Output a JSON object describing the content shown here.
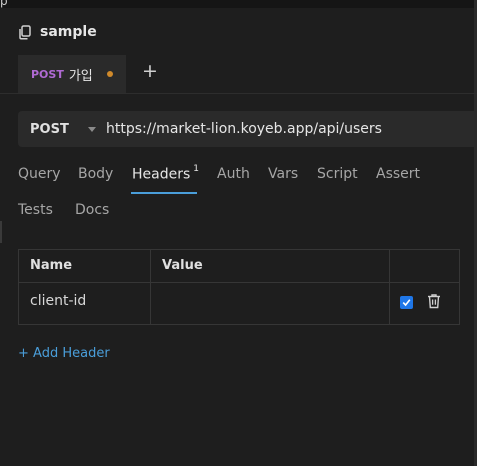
{
  "window": {
    "corner_glyph": "p"
  },
  "collection": {
    "icon": "copy-icon",
    "title": "sample"
  },
  "tabs": [
    {
      "method": "POST",
      "name": "가입",
      "unsaved": true
    }
  ],
  "new_tab": {
    "label": "+"
  },
  "request": {
    "method": "POST",
    "url": "https://market-lion.koyeb.app/api/users"
  },
  "request_tabs": [
    {
      "label": "Query"
    },
    {
      "label": "Body"
    },
    {
      "label": "Headers",
      "count": "1",
      "active": true
    },
    {
      "label": "Auth"
    },
    {
      "label": "Vars"
    },
    {
      "label": "Script"
    },
    {
      "label": "Assert"
    },
    {
      "label": "Tests"
    },
    {
      "label": "Docs"
    }
  ],
  "headers_table": {
    "columns": [
      "Name",
      "Value",
      ""
    ],
    "rows": [
      {
        "name": "client-id",
        "value": "",
        "enabled": true
      }
    ]
  },
  "add_header_label": "+ Add Header",
  "colors": {
    "method_purple": "#b06ad3",
    "unsaved_dot": "#d08a2b",
    "accent_blue": "#4a9eda",
    "checkbox_blue": "#1f77e8"
  }
}
